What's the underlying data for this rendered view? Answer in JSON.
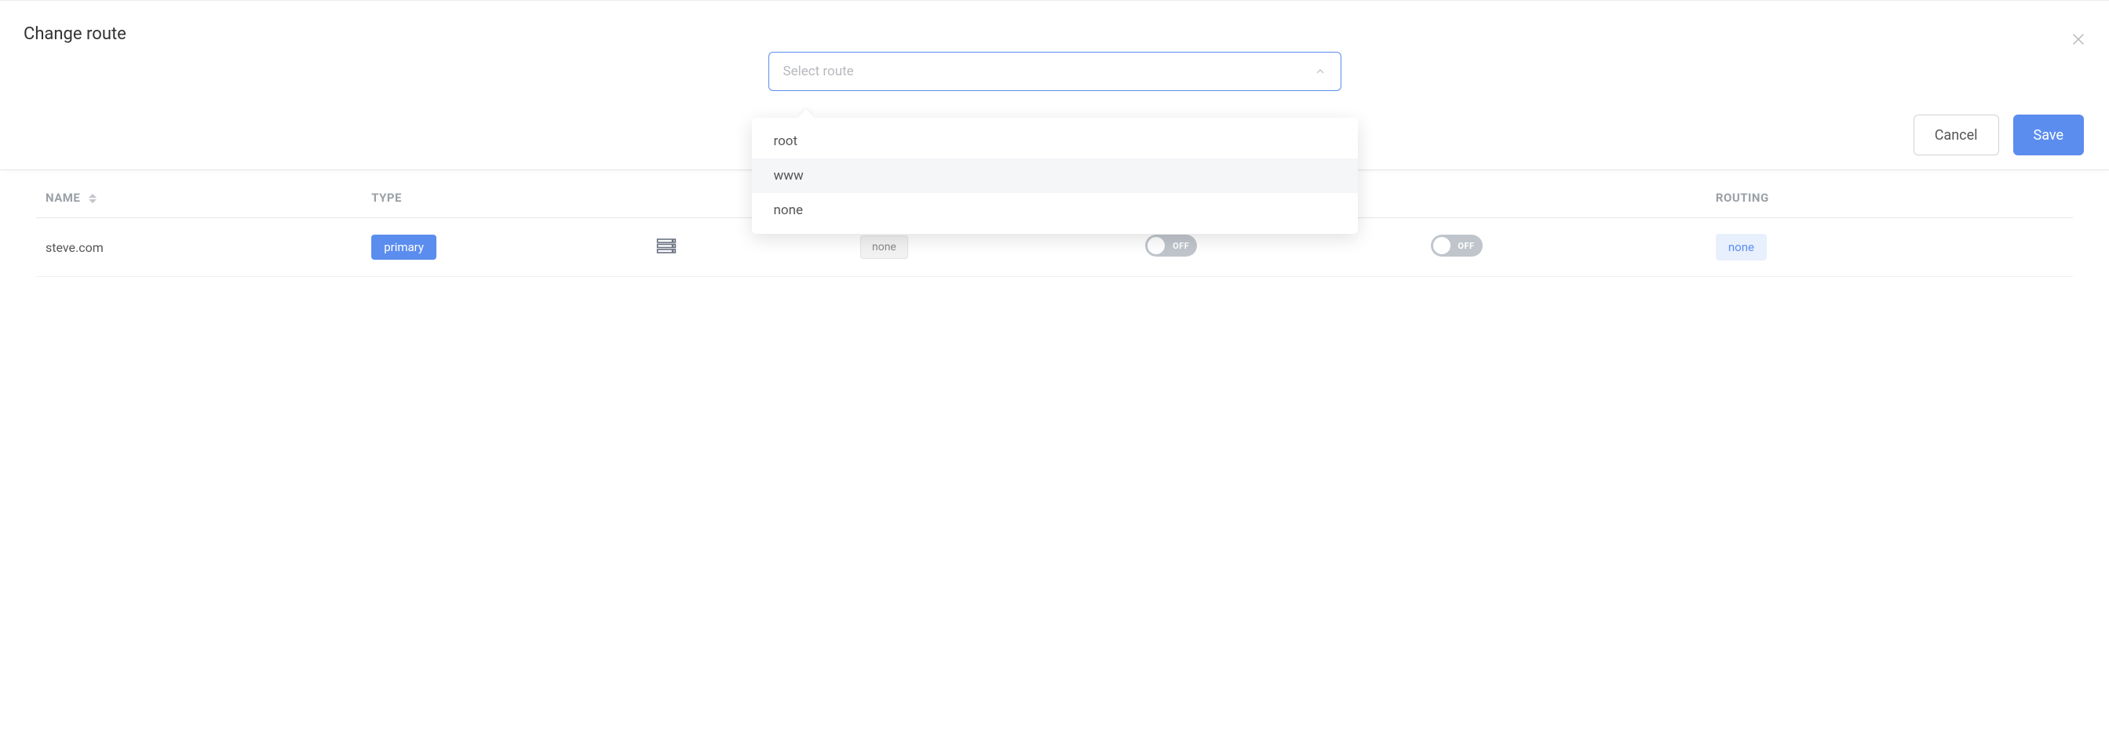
{
  "modal": {
    "title": "Change route",
    "select_placeholder": "Select route",
    "options": [
      "root",
      "www",
      "none"
    ],
    "highlighted_index": 1,
    "cancel_label": "Cancel",
    "save_label": "Save"
  },
  "table": {
    "headers": {
      "name": "NAME",
      "type": "TYPE",
      "records": "",
      "redirect": "",
      "toggle_a": "",
      "toggle_b": "",
      "routing": "ROUTING"
    },
    "rows": [
      {
        "name": "steve.com",
        "type_tag": "primary",
        "redirect": "none",
        "toggle_a": "OFF",
        "toggle_b": "OFF",
        "routing": "none"
      }
    ]
  }
}
